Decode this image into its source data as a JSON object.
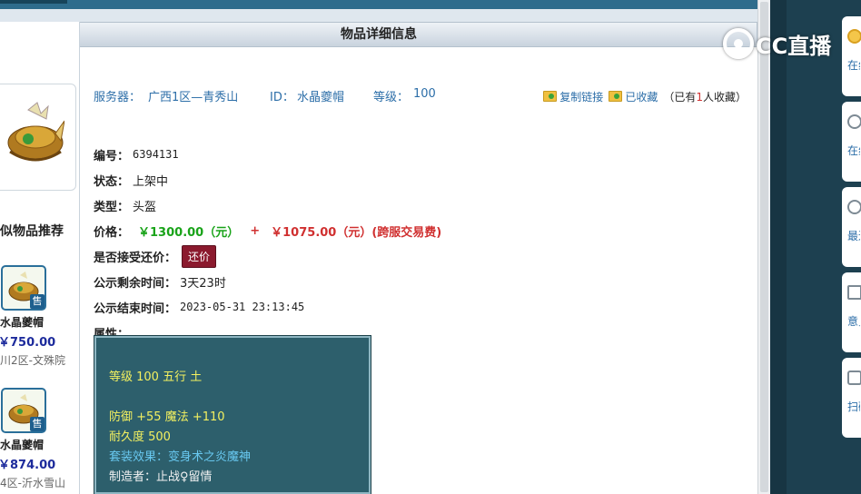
{
  "page": {
    "header_title": "物品详细信息",
    "watermark": "CC直播"
  },
  "info": {
    "server_label": "服务器：",
    "server_value": "广西1区—青秀山",
    "id_label": "ID：",
    "id_value": "水晶夔帽",
    "level_label": "等级：",
    "level_value": "100"
  },
  "actions": {
    "copy_link": "复制链接",
    "favorited": "已收藏",
    "fav_count_prefix": "（已有",
    "fav_count": "1",
    "fav_count_suffix": "人收藏）"
  },
  "details": {
    "number_label": "编号：",
    "number_value": "6394131",
    "status_label": "状态：",
    "status_value": "上架中",
    "type_label": "类型：",
    "type_value": "头盔",
    "price_label": "价格：",
    "price_value": "￥1300.00（元）",
    "price_plus": "+",
    "fee_value": "￥1075.00（元）(跨服交易费)",
    "counter_label": "是否接受还价：",
    "counter_button": "还价",
    "remain_label": "公示剩余时间：",
    "remain_value": "3天23时",
    "end_label": "公示结束时间：",
    "end_value": "2023-05-31 23:13:45",
    "attr_label": "属性："
  },
  "tooltip": {
    "line1": "等级 100 五行 土",
    "line2": "防御 +55 魔法 +110",
    "line3": "耐久度 500",
    "line4": "套装效果：变身术之炎魔神",
    "line5": "制造者：止战♀留情"
  },
  "recommend": {
    "title": "似物品推荐",
    "sell_badge": "售",
    "items": [
      {
        "name": "水晶夔帽",
        "price": "￥750.00",
        "server": "川2区-文殊院"
      },
      {
        "name": "水晶夔帽",
        "price": "￥874.00",
        "server": "4区-沂水雪山"
      }
    ]
  },
  "side_buttons": [
    {
      "text": "在线精选"
    },
    {
      "text": "在线客服"
    },
    {
      "text": "最近浏览"
    },
    {
      "text": "意见反馈"
    },
    {
      "text": "扫码下载"
    }
  ],
  "colors": {
    "link_blue": "#2c6ea8",
    "price_green": "#19a319",
    "price_red": "#d03030",
    "tooltip_bg": "#2d5f6c",
    "tooltip_yellow": "#f3f060",
    "tooltip_blue": "#68c8f0"
  }
}
